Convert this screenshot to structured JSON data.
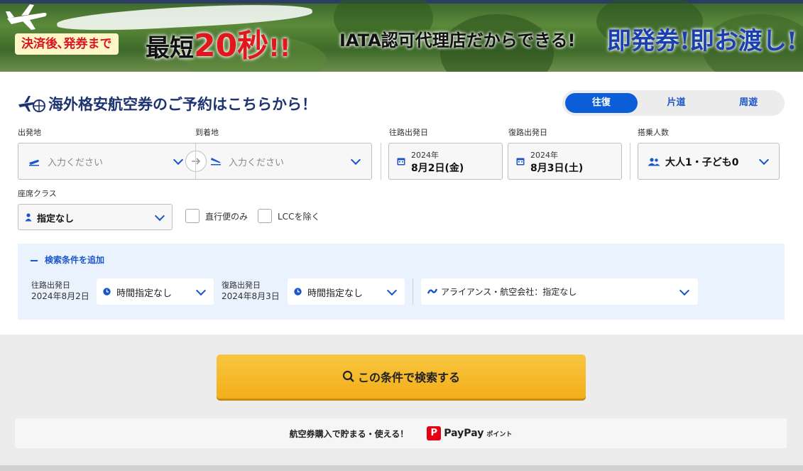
{
  "banner": {
    "after_payment": "決済後､発券まで",
    "fastest_prefix": "最短",
    "fastest_num": "20秒",
    "fastest_suffix": "!!",
    "iata": "IATA認可代理店だからできる!",
    "instant": "即発券!即お渡し!"
  },
  "header": {
    "title": "海外格安航空券のご予約はこちらから！",
    "trip_tabs": [
      "往復",
      "片道",
      "周遊"
    ],
    "active_tab": "往復"
  },
  "form": {
    "origin": {
      "label": "出発地",
      "placeholder": "入力ください"
    },
    "destination": {
      "label": "到着地",
      "placeholder": "入力ください"
    },
    "outbound": {
      "label": "往路出発日",
      "year": "2024年",
      "date": "8月2日(金)"
    },
    "return": {
      "label": "復路出発日",
      "year": "2024年",
      "date": "8月3日(土)"
    },
    "passengers": {
      "label": "搭乗人数",
      "value": "大人1・子ども0"
    },
    "cabin": {
      "label": "座席クラス",
      "value": "指定なし"
    },
    "direct_only": "直行便のみ",
    "exclude_lcc": "LCCを除く"
  },
  "advanced": {
    "toggle": "検索条件を追加",
    "outbound_label": "往路出発日",
    "outbound_date": "2024年8月2日",
    "outbound_time": "時間指定なし",
    "return_label": "復路出発日",
    "return_date": "2024年8月3日",
    "return_time": "時間指定なし",
    "airline": "アライアンス・航空会社：指定なし"
  },
  "search_button": "この条件で検索する",
  "paypay": {
    "text": "航空券購入で貯まる・使える！",
    "brand": "PayPay",
    "points": "ポイント"
  },
  "colors": {
    "primary": "#0b5ed7",
    "accent_yellow": "#f5b526",
    "title_navy": "#1d3470"
  }
}
